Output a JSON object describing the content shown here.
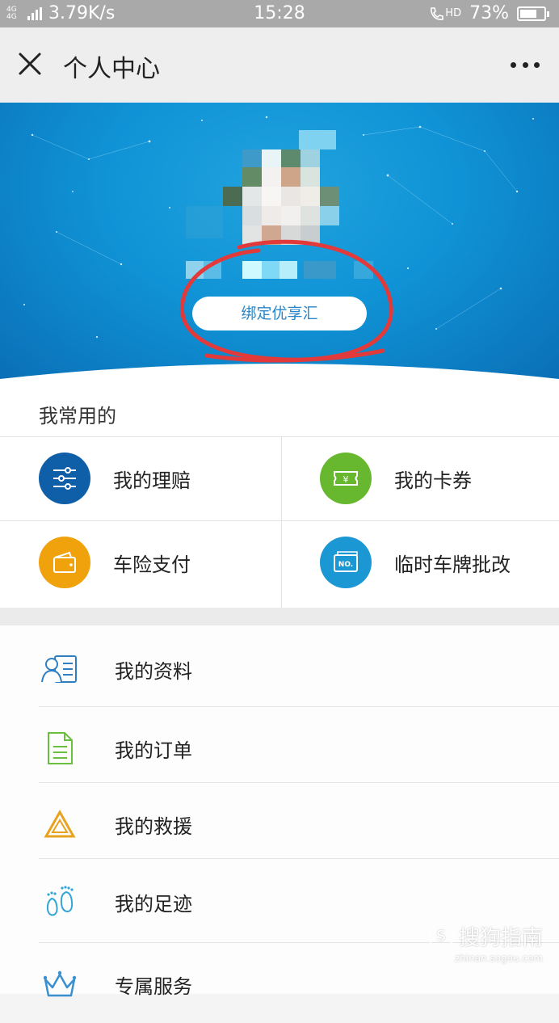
{
  "status_bar": {
    "network": "4G 4G",
    "speed": "3.79K/s",
    "time": "15:28",
    "hd": "HD",
    "battery": "73%",
    "battery_level": 0.73
  },
  "titlebar": {
    "title": "个人中心"
  },
  "hero": {
    "bind_button": "绑定优享汇"
  },
  "common": {
    "title": "我常用的",
    "items": [
      {
        "label": "我的理赔",
        "icon": "sliders-icon",
        "color": "#0f5ea8"
      },
      {
        "label": "我的卡券",
        "icon": "coupon-icon",
        "color": "#67b82f"
      },
      {
        "label": "车险支付",
        "icon": "wallet-icon",
        "color": "#f0a20c"
      },
      {
        "label": "临时车牌批改",
        "icon": "license-plate-icon",
        "color": "#1b97d3"
      }
    ]
  },
  "menu": {
    "items": [
      {
        "label": "我的资料",
        "icon": "profile-card-icon",
        "color": "#2f7fc1"
      },
      {
        "label": "我的订单",
        "icon": "document-icon",
        "color": "#6abf3e"
      },
      {
        "label": "我的救援",
        "icon": "warning-triangle-icon",
        "color": "#e7a320"
      },
      {
        "label": "我的足迹",
        "icon": "footprints-icon",
        "color": "#33a6d8"
      },
      {
        "label": "专属服务",
        "icon": "crown-icon",
        "color": "#3a8fd0"
      }
    ]
  },
  "watermark": {
    "text": "搜狗指南",
    "logo": "S",
    "url": "zhinan.sogou.com"
  }
}
